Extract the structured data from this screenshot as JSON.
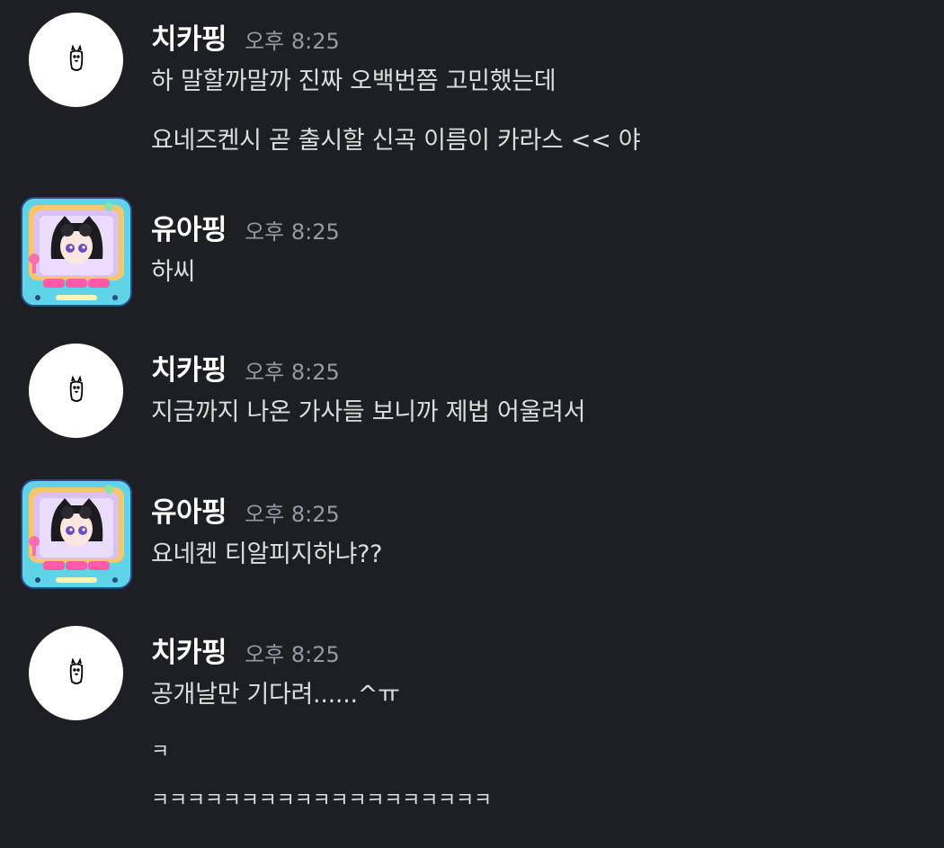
{
  "messages": [
    {
      "username": "치카핑",
      "time": "오후 8:25",
      "avatar": "bunny-avatar",
      "lines": [
        "하 말할까말까 진짜 오백번쯤 고민했는데",
        "요네즈켄시 곧 출시할 신곡 이름이 카라스 << 야"
      ]
    },
    {
      "username": "유아핑",
      "time": "오후 8:25",
      "avatar": "claw-machine-avatar",
      "lines": [
        "하씨"
      ]
    },
    {
      "username": "치카핑",
      "time": "오후 8:25",
      "avatar": "bunny-avatar",
      "lines": [
        "지금까지 나온 가사들 보니까 제법 어울려서"
      ]
    },
    {
      "username": "유아핑",
      "time": "오후 8:25",
      "avatar": "claw-machine-avatar",
      "lines": [
        "요네켄 티알피지하냐??"
      ]
    },
    {
      "username": "치카핑",
      "time": "오후 8:25",
      "avatar": "bunny-avatar",
      "lines": [
        "공개날만 기다려......^ㅠ",
        "ㅋ",
        "ㅋㅋㅋㅋㅋㅋㅋㅋㅋㅋㅋㅋㅋㅋㅋㅋㅋㅋㅋ"
      ]
    }
  ]
}
